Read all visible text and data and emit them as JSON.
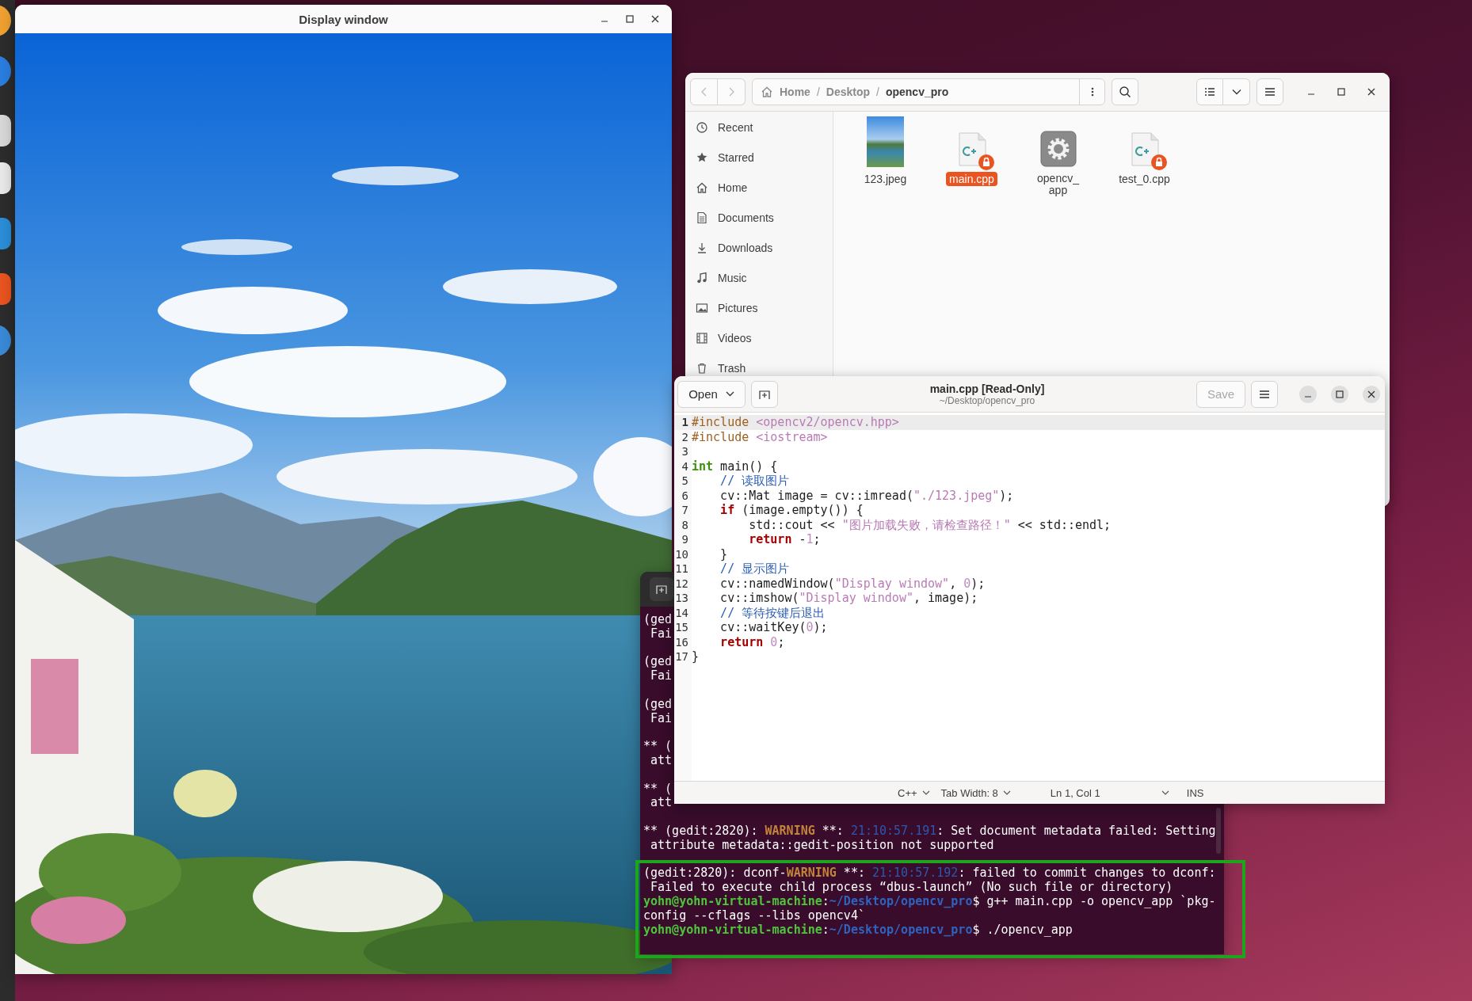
{
  "display_window": {
    "title": "Display window"
  },
  "file_manager": {
    "path": [
      {
        "kind": "crumb",
        "label": "Home",
        "current": false
      },
      {
        "kind": "separator",
        "label": "/"
      },
      {
        "kind": "crumb",
        "label": "Desktop",
        "current": false
      },
      {
        "kind": "separator",
        "label": "/"
      },
      {
        "kind": "crumb",
        "label": "opencv_pro",
        "current": true
      }
    ],
    "sidebar": [
      {
        "label": "Recent"
      },
      {
        "label": "Starred"
      },
      {
        "label": "Home"
      },
      {
        "label": "Documents"
      },
      {
        "label": "Downloads"
      },
      {
        "label": "Music"
      },
      {
        "label": "Pictures"
      },
      {
        "label": "Videos"
      },
      {
        "label": "Trash"
      }
    ],
    "files": [
      {
        "name": "123.jpeg",
        "kind": "image",
        "selected": false,
        "locked": false
      },
      {
        "name": "main.cpp",
        "kind": "source",
        "selected": true,
        "locked": true
      },
      {
        "name": "opencv_app",
        "kind": "executable",
        "selected": false,
        "locked": false
      },
      {
        "name": "test_0.cpp",
        "kind": "source",
        "selected": false,
        "locked": true
      }
    ]
  },
  "terminal": {
    "lines": [
      {
        "kind": "text",
        "segments": [
          {
            "kind": "plain",
            "text": "(ged"
          }
        ]
      },
      {
        "kind": "text",
        "segments": [
          {
            "kind": "plain",
            "text": " Fai"
          }
        ]
      },
      {
        "kind": "blank"
      },
      {
        "kind": "text",
        "segments": [
          {
            "kind": "plain",
            "text": "(ged"
          }
        ]
      },
      {
        "kind": "text",
        "segments": [
          {
            "kind": "plain",
            "text": " Fai"
          }
        ]
      },
      {
        "kind": "blank"
      },
      {
        "kind": "text",
        "segments": [
          {
            "kind": "plain",
            "text": "(ged"
          }
        ]
      },
      {
        "kind": "text",
        "segments": [
          {
            "kind": "plain",
            "text": " Fai"
          }
        ]
      },
      {
        "kind": "blank"
      },
      {
        "kind": "text",
        "segments": [
          {
            "kind": "plain",
            "text": "** ("
          }
        ]
      },
      {
        "kind": "text",
        "segments": [
          {
            "kind": "plain",
            "text": " att"
          }
        ]
      },
      {
        "kind": "blank"
      },
      {
        "kind": "text",
        "segments": [
          {
            "kind": "plain",
            "text": "** ("
          }
        ]
      },
      {
        "kind": "text",
        "segments": [
          {
            "kind": "plain",
            "text": " att"
          }
        ]
      },
      {
        "kind": "blank"
      },
      {
        "kind": "text",
        "segments": [
          {
            "kind": "plain",
            "text": "** (gedit:2820): "
          },
          {
            "kind": "warning",
            "text": "WARNING"
          },
          {
            "kind": "plain",
            "text": " **: "
          },
          {
            "kind": "time",
            "text": "21:10:57.191"
          },
          {
            "kind": "plain",
            "text": ": Set document metadata failed: Setting"
          }
        ]
      },
      {
        "kind": "text",
        "segments": [
          {
            "kind": "plain",
            "text": " attribute metadata::gedit-position not supported"
          }
        ]
      },
      {
        "kind": "blank"
      },
      {
        "kind": "text",
        "segments": [
          {
            "kind": "plain",
            "text": "(gedit:2820): dconf-"
          },
          {
            "kind": "warning",
            "text": "WARNING"
          },
          {
            "kind": "plain",
            "text": " **: "
          },
          {
            "kind": "time",
            "text": "21:10:57.192"
          },
          {
            "kind": "plain",
            "text": ": failed to commit changes to dconf:"
          }
        ]
      },
      {
        "kind": "text",
        "segments": [
          {
            "kind": "plain",
            "text": " Failed to execute child process “dbus-launch” (No such file or directory)"
          }
        ]
      },
      {
        "kind": "text",
        "segments": [
          {
            "kind": "user",
            "text": "yohn@yohn-virtual-machine"
          },
          {
            "kind": "plain",
            "text": ":"
          },
          {
            "kind": "path",
            "text": "~/Desktop/opencv_pro"
          },
          {
            "kind": "plain",
            "text": "$ g++ main.cpp -o opencv_app `pkg-"
          }
        ]
      },
      {
        "kind": "text",
        "segments": [
          {
            "kind": "plain",
            "text": "config --cflags --libs opencv4`"
          }
        ]
      },
      {
        "kind": "text",
        "segments": [
          {
            "kind": "user",
            "text": "yohn@yohn-virtual-machine"
          },
          {
            "kind": "plain",
            "text": ":"
          },
          {
            "kind": "path",
            "text": "~/Desktop/opencv_pro"
          },
          {
            "kind": "plain",
            "text": "$ ./opencv_app"
          }
        ]
      }
    ]
  },
  "editor": {
    "open_label": "Open",
    "title": "main.cpp [Read-Only]",
    "subtitle": "~/Desktop/opencv_pro",
    "save": {
      "label": "Save",
      "disabled": true
    },
    "lines": [
      {
        "number": "1",
        "current": true,
        "segments": [
          {
            "kind": "preproc",
            "text": "#include "
          },
          {
            "kind": "string",
            "text": "<opencv2/opencv.hpp>"
          }
        ]
      },
      {
        "number": "2",
        "current": false,
        "segments": [
          {
            "kind": "preproc",
            "text": "#include "
          },
          {
            "kind": "string",
            "text": "<iostream>"
          }
        ]
      },
      {
        "number": "3",
        "current": false
      },
      {
        "number": "4",
        "current": false,
        "segments": [
          {
            "kind": "type",
            "text": "int"
          },
          {
            "kind": "plain",
            "text": " main() {"
          }
        ]
      },
      {
        "number": "5",
        "current": false,
        "segments": [
          {
            "kind": "comment",
            "text": "    // 读取图片"
          }
        ]
      },
      {
        "number": "6",
        "current": false,
        "segments": [
          {
            "kind": "plain",
            "text": "    cv::Mat image = cv::imread("
          },
          {
            "kind": "string",
            "text": "\"./123.jpeg\""
          },
          {
            "kind": "plain",
            "text": ");"
          }
        ]
      },
      {
        "number": "7",
        "current": false,
        "segments": [
          {
            "kind": "keyword",
            "text": "    if"
          },
          {
            "kind": "plain",
            "text": " (image.empty()) {"
          }
        ]
      },
      {
        "number": "8",
        "current": false,
        "segments": [
          {
            "kind": "plain",
            "text": "        std::cout << "
          },
          {
            "kind": "string",
            "text": "\"图片加载失败，请检查路径！\""
          },
          {
            "kind": "plain",
            "text": " << std::endl;"
          }
        ]
      },
      {
        "number": "9",
        "current": false,
        "segments": [
          {
            "kind": "keyword",
            "text": "        return"
          },
          {
            "kind": "plain",
            "text": " -"
          },
          {
            "kind": "number",
            "text": "1"
          },
          {
            "kind": "plain",
            "text": ";"
          }
        ]
      },
      {
        "number": "10",
        "current": false,
        "segments": [
          {
            "kind": "plain",
            "text": "    }"
          }
        ]
      },
      {
        "number": "11",
        "current": false,
        "segments": [
          {
            "kind": "comment",
            "text": "    // 显示图片"
          }
        ]
      },
      {
        "number": "12",
        "current": false,
        "segments": [
          {
            "kind": "plain",
            "text": "    cv::namedWindow("
          },
          {
            "kind": "string",
            "text": "\"Display window\""
          },
          {
            "kind": "plain",
            "text": ", "
          },
          {
            "kind": "number",
            "text": "0"
          },
          {
            "kind": "plain",
            "text": ");"
          }
        ]
      },
      {
        "number": "13",
        "current": false,
        "segments": [
          {
            "kind": "plain",
            "text": "    cv::imshow("
          },
          {
            "kind": "string",
            "text": "\"Display window\""
          },
          {
            "kind": "plain",
            "text": ", image);"
          }
        ]
      },
      {
        "number": "14",
        "current": false,
        "segments": [
          {
            "kind": "comment",
            "text": "    // 等待按键后退出"
          }
        ]
      },
      {
        "number": "15",
        "current": false,
        "segments": [
          {
            "kind": "plain",
            "text": "    cv::waitKey("
          },
          {
            "kind": "number",
            "text": "0"
          },
          {
            "kind": "plain",
            "text": ");"
          }
        ]
      },
      {
        "number": "16",
        "current": false,
        "segments": [
          {
            "kind": "keyword",
            "text": "    return"
          },
          {
            "kind": "number",
            "text": " 0"
          },
          {
            "kind": "plain",
            "text": ";"
          }
        ]
      },
      {
        "number": "17",
        "current": false,
        "segments": [
          {
            "kind": "plain",
            "text": "}"
          }
        ]
      }
    ],
    "status": {
      "language": "C++",
      "tab_width": "Tab Width: 8",
      "position": "Ln 1, Col 1",
      "mode": "INS"
    }
  }
}
